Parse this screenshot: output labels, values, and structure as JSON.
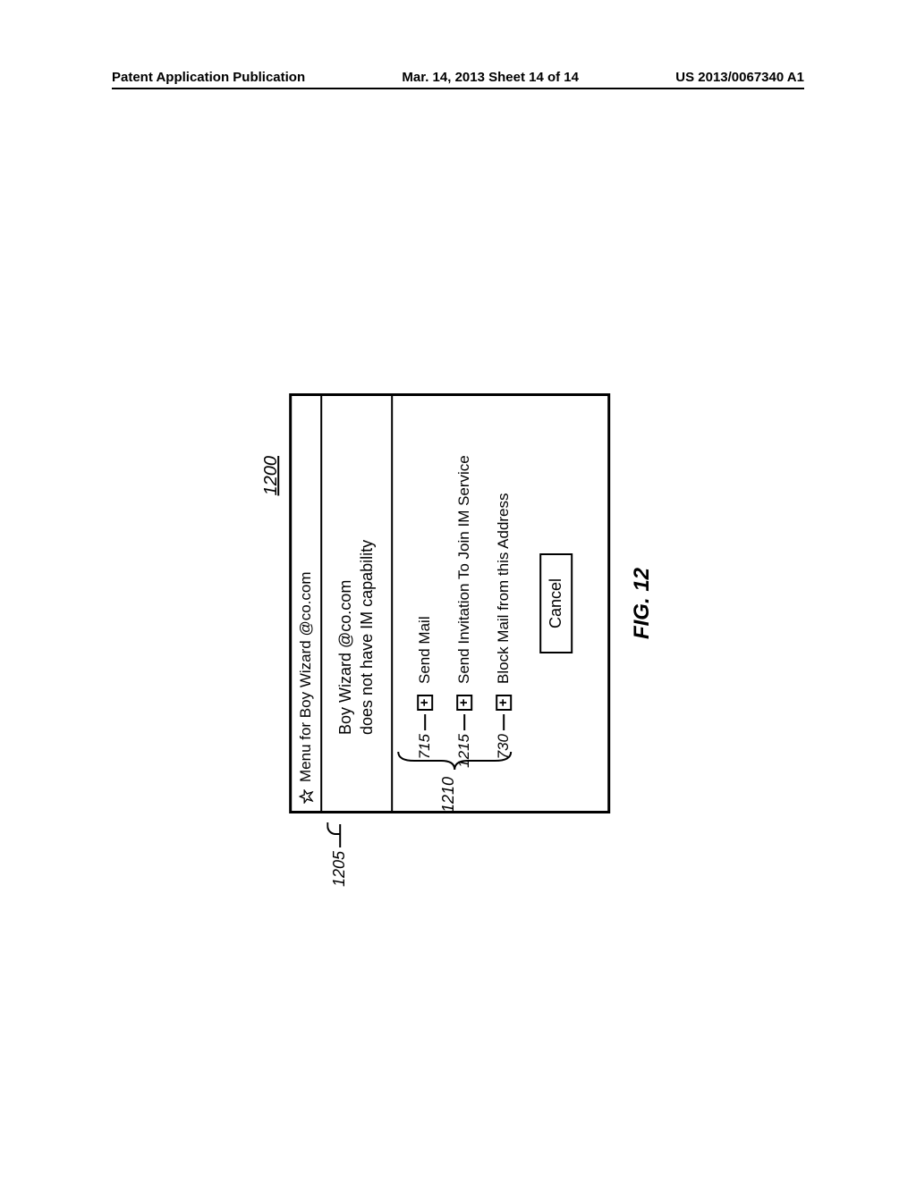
{
  "header": {
    "left": "Patent Application Publication",
    "center": "Mar. 14, 2013  Sheet 14 of 14",
    "right": "US 2013/0067340 A1"
  },
  "refs": {
    "top": "1200",
    "info": "1205",
    "group": "1210",
    "item1": "715",
    "item2": "1215",
    "item3": "730"
  },
  "window": {
    "title": "Menu for Boy Wizard  @co.com",
    "info_line1": "Boy Wizard   @co.com",
    "info_line2": "does not have IM capability"
  },
  "menu": {
    "item1": "Send Mail",
    "item2": "Send Invitation To Join IM Service",
    "item3": "Block Mail from this Address"
  },
  "buttons": {
    "cancel": "Cancel"
  },
  "caption": "FIG. 12"
}
